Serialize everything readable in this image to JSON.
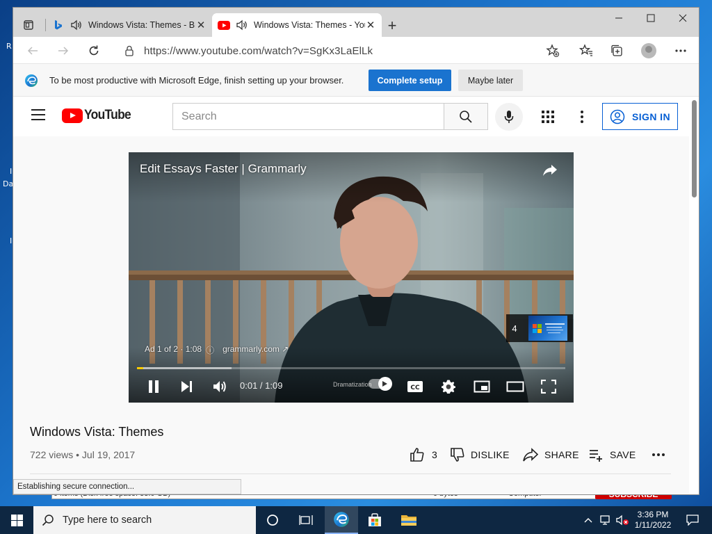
{
  "desktop": {
    "fragments": [
      "R",
      "Da",
      "I",
      "I"
    ],
    "behind_window": {
      "status_text": "0 items (Disk free space: 33.0 GB)",
      "size_text": "0 bytes",
      "computer_text": "Computer"
    },
    "subscribe_peek": "SUBSCRIBE"
  },
  "browser": {
    "tabs": [
      {
        "title": "Windows Vista: Themes - Bing",
        "favicon": "bing-logo",
        "audio": true
      },
      {
        "title": "Windows Vista: Themes - YouTube",
        "favicon": "youtube-logo",
        "audio": true
      }
    ],
    "new_tab": "+",
    "window_controls": [
      "minimize",
      "maximize",
      "close"
    ],
    "address": {
      "url": "https://www.youtube.com/watch?v=SgKx3LaElLk"
    },
    "infobar": {
      "message": "To be most productive with Microsoft Edge, finish setting up your browser.",
      "primary": "Complete setup",
      "secondary": "Maybe later"
    },
    "status": "Establishing secure connection..."
  },
  "youtube": {
    "logo_text": "YouTube",
    "search_placeholder": "Search",
    "signin": "SIGN IN",
    "player": {
      "ad_title": "Edit Essays Faster | Grammarly",
      "ad_info": "Ad 1 of 2 · 1:08",
      "ad_domain": "grammarly.com",
      "next_count": "4",
      "time": "0:01 / 1:09",
      "dramatization": "Dramatization",
      "progress": 0.015,
      "buffered": 0.22
    },
    "video": {
      "title": "Windows Vista: Themes",
      "meta": "722 views • Jul 19, 2017",
      "likes": "3",
      "dislike": "DISLIKE",
      "share": "SHARE",
      "save": "SAVE"
    }
  },
  "taskbar": {
    "search_placeholder": "Type here to search",
    "time": "3:36 PM",
    "date": "1/11/2022"
  },
  "colors": {
    "accent": "#1a73cf",
    "youtube_red": "#ff0000",
    "signin_blue": "#065fd4",
    "progress": "#ffcc00",
    "taskbar": "#0e2742"
  }
}
